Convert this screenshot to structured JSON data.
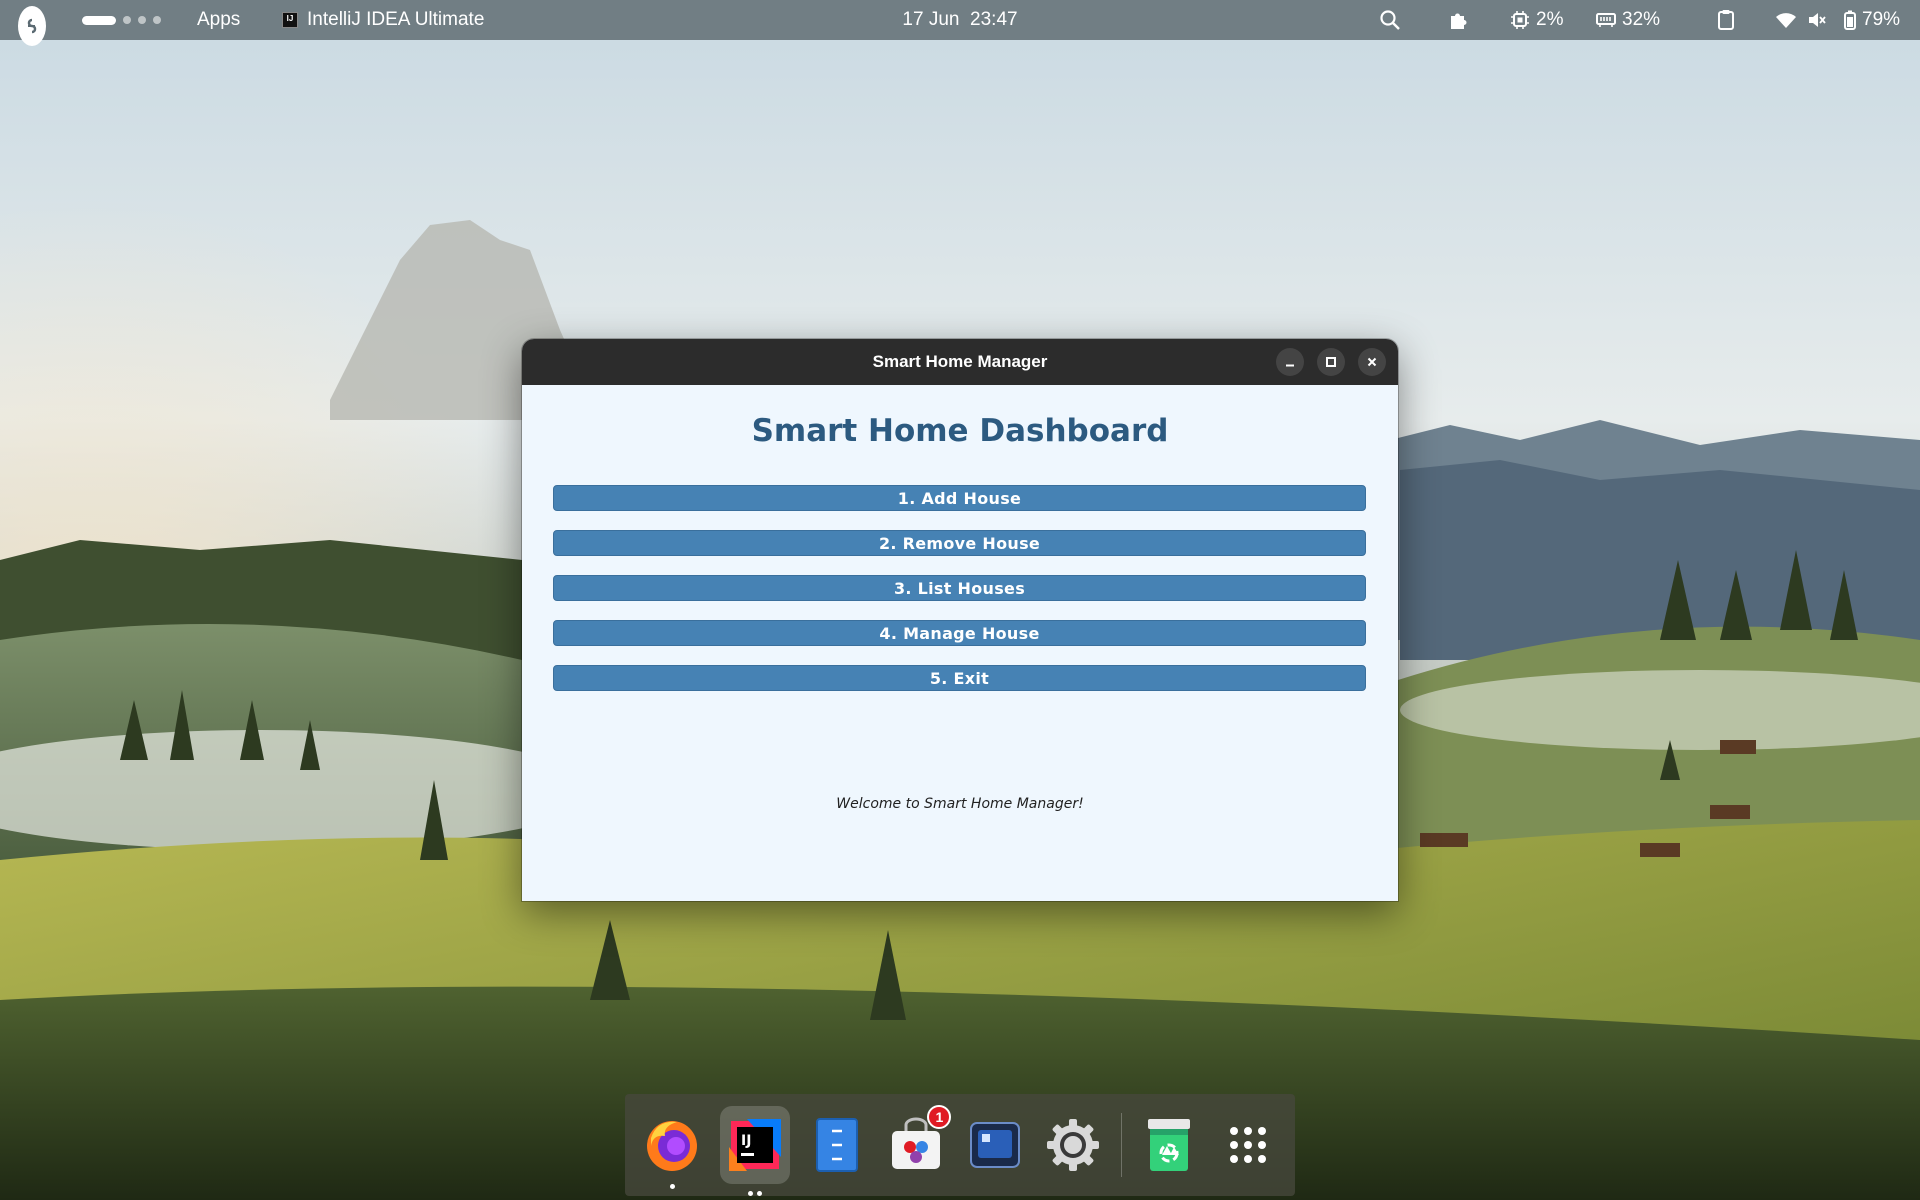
{
  "topbar": {
    "apps_label": "Apps",
    "focused_app": "IntelliJ IDEA Ultimate",
    "clock": "17 Jun  23:47",
    "cpu_percent": "2%",
    "ram_percent": "32%",
    "battery_percent": "79%"
  },
  "window": {
    "title": "Smart Home Manager",
    "heading": "Smart Home Dashboard",
    "buttons": [
      "1. Add House",
      "2. Remove House",
      "3. List Houses",
      "4. Manage House",
      "5. Exit"
    ],
    "status": "Welcome to Smart Home Manager!"
  },
  "dock": {
    "items": [
      {
        "name": "firefox",
        "icon": "firefox-icon"
      },
      {
        "name": "intellij-idea",
        "icon": "intellij-icon"
      },
      {
        "name": "text-editor",
        "icon": "text-editor-icon"
      },
      {
        "name": "software",
        "icon": "software-store-icon",
        "badge": "1"
      },
      {
        "name": "boxes",
        "icon": "boxes-icon"
      },
      {
        "name": "settings",
        "icon": "settings-gear-icon"
      },
      {
        "name": "trash",
        "icon": "trash-icon"
      },
      {
        "name": "show-apps",
        "icon": "app-grid-icon"
      }
    ]
  },
  "colors": {
    "accent": "#4682b4",
    "heading": "#2c5a80",
    "window_bg": "#eff7fe",
    "titlebar": "#2c2c2c"
  }
}
